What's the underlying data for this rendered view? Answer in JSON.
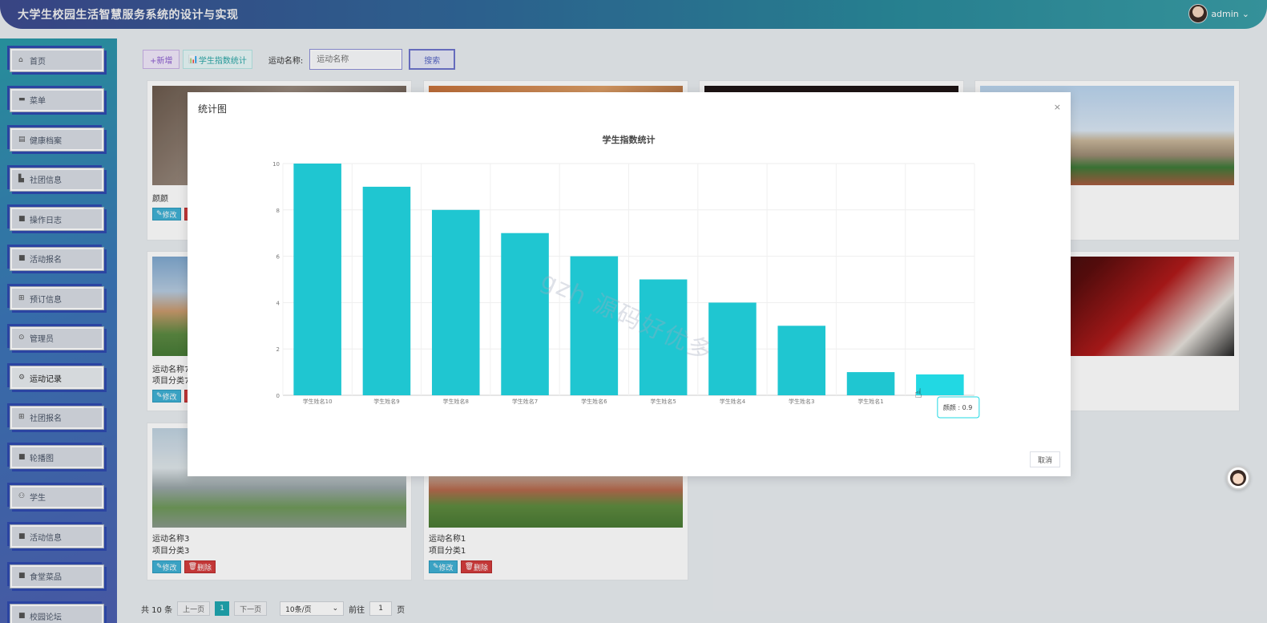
{
  "header": {
    "title": "大学生校园生活智慧服务系统的设计与实现",
    "username": "admin",
    "dropdown_icon": "chevron-down-icon"
  },
  "sidebar": {
    "items": [
      {
        "label": "首页",
        "icon": "home-icon"
      },
      {
        "label": "菜单",
        "icon": "folder-icon"
      },
      {
        "label": "健康档案",
        "icon": "book-icon"
      },
      {
        "label": "社团信息",
        "icon": "building-icon"
      },
      {
        "label": "操作日志",
        "icon": "list-icon"
      },
      {
        "label": "活动报名",
        "icon": "list-icon"
      },
      {
        "label": "预订信息",
        "icon": "grid-icon"
      },
      {
        "label": "管理员",
        "icon": "lock-icon"
      },
      {
        "label": "运动记录",
        "icon": "gear-icon",
        "active": true
      },
      {
        "label": "社团报名",
        "icon": "grid-icon"
      },
      {
        "label": "轮播图",
        "icon": "list-icon"
      },
      {
        "label": "学生",
        "icon": "user-icon"
      },
      {
        "label": "活动信息",
        "icon": "list-icon"
      },
      {
        "label": "食堂菜品",
        "icon": "list-icon"
      },
      {
        "label": "校园论坛",
        "icon": "list-icon"
      }
    ]
  },
  "toolbar": {
    "add_label": "+新增",
    "stat_label": "学生指数统计",
    "search_label": "运动名称:",
    "search_placeholder": "运动名称",
    "search_button": "搜索"
  },
  "cards": [
    {
      "name": "颜颜",
      "category": "",
      "edit": "修改",
      "delete": "删除"
    },
    {
      "name": "运动名称7",
      "category": "项目分类7",
      "edit": "修改",
      "delete": "删除"
    },
    {
      "name": "运动名称3",
      "category": "项目分类3",
      "edit": "修改",
      "delete": "删除"
    },
    {
      "name": "运动名称1",
      "category": "项目分类1",
      "edit": "修改",
      "delete": "删除"
    }
  ],
  "pagination": {
    "total": "共 10 条",
    "prev": "上一页",
    "current": "1",
    "next": "下一页",
    "page_size": "10条/页",
    "goto_label": "前往",
    "goto_value": "1",
    "page_suffix": "页"
  },
  "modal": {
    "title": "统计图",
    "close": "×",
    "cancel": "取消"
  },
  "tooltip": {
    "label": "颜颜 : 0.9"
  },
  "watermark": "gzh 源码好优多",
  "chart_data": {
    "type": "bar",
    "title": "学生指数统计",
    "categories": [
      "学生姓名10",
      "学生姓名9",
      "学生姓名8",
      "学生姓名7",
      "学生姓名6",
      "学生姓名5",
      "学生姓名4",
      "学生姓名3",
      "学生姓名1",
      "颜颜"
    ],
    "visible_category_labels": [
      "学生姓名10",
      "学生姓名9",
      "学生姓名8",
      "学生姓名7",
      "学生姓名6",
      "学生姓名5",
      "学生姓名4",
      "学生姓名3",
      "学生姓名1",
      ""
    ],
    "values": [
      10,
      9,
      8,
      7,
      6,
      5,
      4,
      3,
      1,
      0.9
    ],
    "ylim": [
      0,
      10
    ],
    "yticks": [
      0,
      2,
      4,
      6,
      8,
      10
    ],
    "grid": true,
    "bar_color": "#1fc6d1",
    "highlight_color": "#22d8e3",
    "highlight_index": 9
  }
}
